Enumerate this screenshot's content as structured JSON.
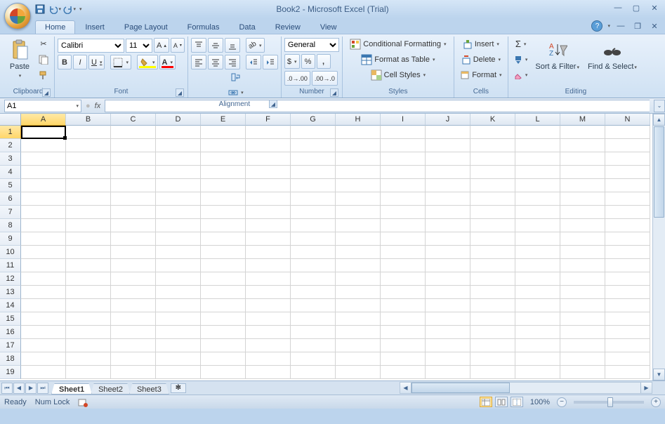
{
  "title": "Book2 - Microsoft Excel (Trial)",
  "qat": {
    "save": "save-icon",
    "undo": "undo-icon",
    "redo": "redo-icon"
  },
  "tabs": [
    "Home",
    "Insert",
    "Page Layout",
    "Formulas",
    "Data",
    "Review",
    "View"
  ],
  "active_tab": "Home",
  "ribbon": {
    "clipboard": {
      "label": "Clipboard",
      "paste": "Paste"
    },
    "font": {
      "label": "Font",
      "name": "Calibri",
      "size": "11",
      "bold": "B",
      "italic": "I",
      "underline": "U"
    },
    "alignment": {
      "label": "Alignment",
      "wrap": "Wrap Text",
      "merge": "Merge & Center"
    },
    "number": {
      "label": "Number",
      "format": "General"
    },
    "styles": {
      "label": "Styles",
      "cond": "Conditional Formatting",
      "table": "Format as Table",
      "cell": "Cell Styles"
    },
    "cells": {
      "label": "Cells",
      "insert": "Insert",
      "delete": "Delete",
      "format": "Format"
    },
    "editing": {
      "label": "Editing",
      "sort": "Sort & Filter",
      "find": "Find & Select"
    }
  },
  "name_box": "A1",
  "formula_bar": "",
  "columns": [
    "A",
    "B",
    "C",
    "D",
    "E",
    "F",
    "G",
    "H",
    "I",
    "J",
    "K",
    "L",
    "M",
    "N"
  ],
  "rows": [
    1,
    2,
    3,
    4,
    5,
    6,
    7,
    8,
    9,
    10,
    11,
    12,
    13,
    14,
    15,
    16,
    17,
    18,
    19
  ],
  "active_cell": "A1",
  "sheets": [
    "Sheet1",
    "Sheet2",
    "Sheet3"
  ],
  "active_sheet": "Sheet1",
  "status": {
    "ready": "Ready",
    "numlock": "Num Lock",
    "zoom": "100%"
  }
}
